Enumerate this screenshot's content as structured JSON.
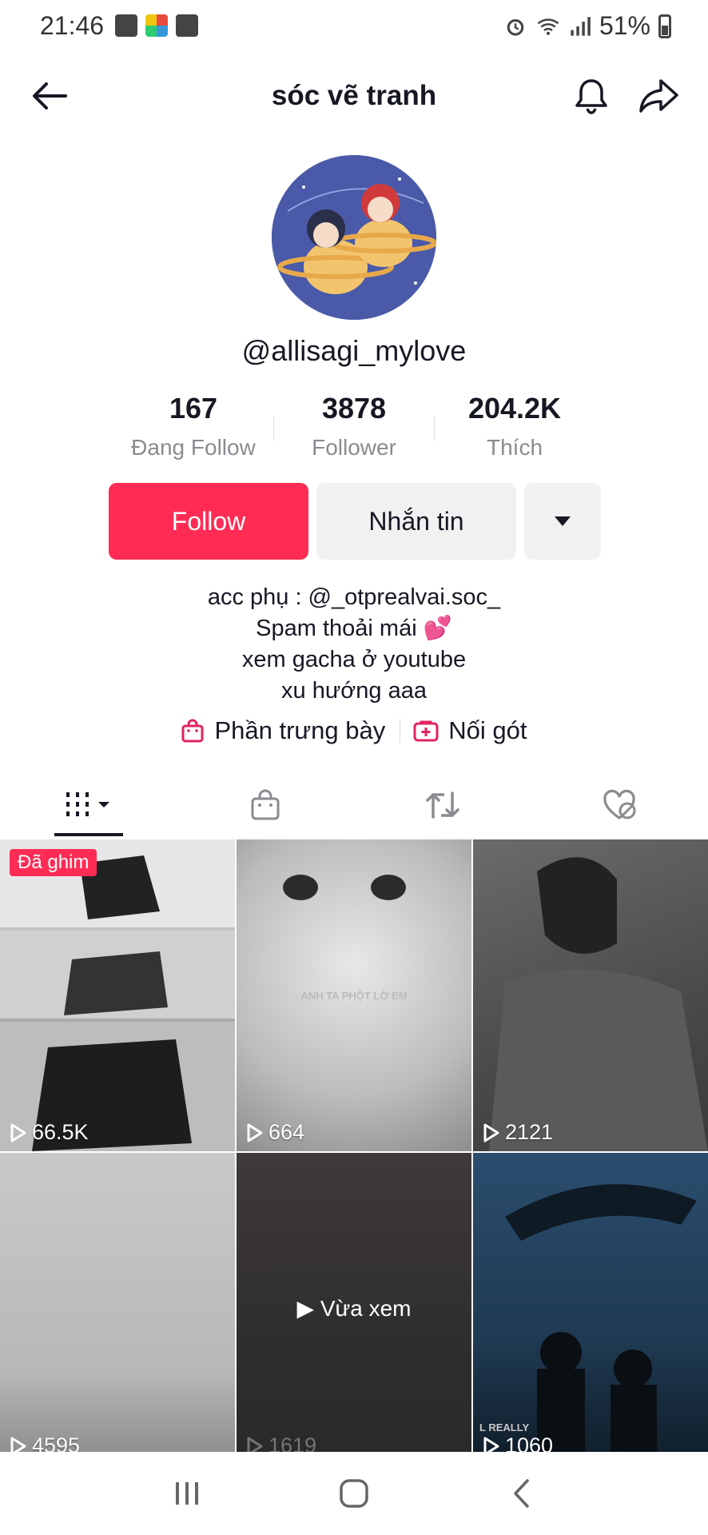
{
  "status_bar": {
    "time": "21:46",
    "battery": "51%",
    "icons_left": [
      "image-icon",
      "apps-icon",
      "clock-icon"
    ],
    "icons_right": [
      "alarm-icon",
      "wifi-icon",
      "signal-icon",
      "battery-icon"
    ]
  },
  "header": {
    "title": "sóc vẽ tranh",
    "back_icon": "arrow-left-icon",
    "bell_icon": "bell-icon",
    "share_icon": "share-icon"
  },
  "profile": {
    "username": "@allisagi_mylove",
    "stats": [
      {
        "value": "167",
        "label": "Đang Follow"
      },
      {
        "value": "3878",
        "label": "Follower"
      },
      {
        "value": "204.2K",
        "label": "Thích"
      }
    ],
    "follow_label": "Follow",
    "message_label": "Nhắn tin",
    "bio": [
      "acc phụ : @_otprealvai.soc_",
      "Spam thoải mái 💕",
      "xem gacha ở youtube",
      "xu hướng aaa"
    ],
    "links": [
      {
        "label": "Phần trưng bày",
        "icon": "shopping-bag-icon"
      },
      {
        "label": "Nối gót",
        "icon": "plus-box-icon"
      }
    ]
  },
  "tabs": [
    {
      "name": "videos",
      "icon": "grid-icon",
      "active": true
    },
    {
      "name": "shop",
      "icon": "bag-icon",
      "active": false
    },
    {
      "name": "reposts",
      "icon": "repost-icon",
      "active": false
    },
    {
      "name": "liked",
      "icon": "liked-hidden-icon",
      "active": false
    }
  ],
  "videos": [
    {
      "views": "66.5K",
      "badge": "Đã ghim",
      "overlay": ""
    },
    {
      "views": "664",
      "badge": "",
      "overlay": "ANH TA PHỘT LỜ EM"
    },
    {
      "views": "2121",
      "badge": "",
      "overlay": ""
    },
    {
      "views": "4595",
      "badge": "",
      "overlay": ""
    },
    {
      "views": "1619",
      "badge": "",
      "overlay": "",
      "watched": "Vừa xem"
    },
    {
      "views": "1060",
      "badge": "",
      "overlay": "L REALLY"
    }
  ],
  "nav": {
    "recent_icon": "recent-apps-icon",
    "home_icon": "home-icon",
    "back_icon": "back-icon"
  },
  "colors": {
    "accent": "#fe2c55",
    "text": "#161823",
    "muted": "#8a8b91",
    "button_bg": "#f1f1f2"
  }
}
